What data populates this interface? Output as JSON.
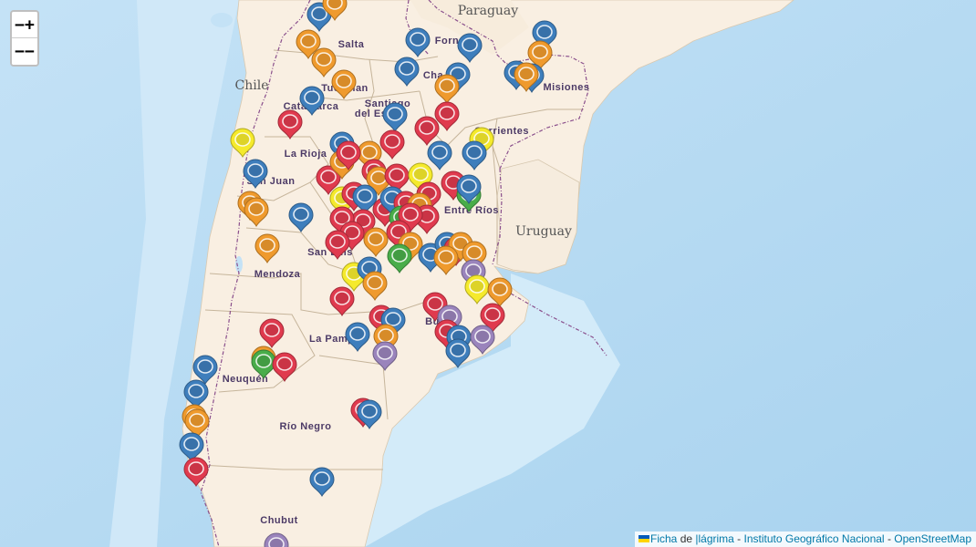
{
  "zoom": {
    "in_label": "−+",
    "out_label": "−−"
  },
  "attribution": {
    "ficha": "Ficha",
    "de": " de ",
    "lagrima": "|lágrima",
    "sep1": " - ",
    "ign": "Instituto Geográfico Nacional",
    "sep2": " - ",
    "osm": "OpenStreetMap",
    "flag_colors": [
      "#005bbb",
      "#ffd500"
    ]
  },
  "countries": [
    "Paraguay",
    "Chile",
    "Uruguay"
  ],
  "provinces": [
    "Salta",
    "Forn",
    "Misiones",
    "Cha",
    "Tucuman",
    "Catamarca",
    "Santiago del Estero",
    "Corrientes",
    "La Rioja",
    "San Juan",
    "Entre Ríos",
    "San Luis",
    "Mendoza",
    "Bu",
    "La Pampa",
    "Neuquén",
    "Río Negro",
    "Chubut"
  ],
  "marker_colors": {
    "blue": "#3e7ebc",
    "orange": "#ef9a2d",
    "red": "#e03a4e",
    "yellow": "#f5ea2c",
    "green": "#49ad4a",
    "purple": "#9a84bc"
  },
  "markers": [
    [
      "blue",
      350,
      18
    ],
    [
      "orange",
      367,
      6
    ],
    [
      "orange",
      338,
      48
    ],
    [
      "orange",
      355,
      68
    ],
    [
      "orange",
      377,
      92
    ],
    [
      "blue",
      458,
      46
    ],
    [
      "blue",
      515,
      52
    ],
    [
      "blue",
      446,
      78
    ],
    [
      "blue",
      502,
      84
    ],
    [
      "orange",
      490,
      97
    ],
    [
      "blue",
      597,
      38
    ],
    [
      "orange",
      592,
      60
    ],
    [
      "blue",
      566,
      82
    ],
    [
      "blue",
      583,
      85
    ],
    [
      "orange",
      577,
      84
    ],
    [
      "blue",
      342,
      110
    ],
    [
      "red",
      318,
      136
    ],
    [
      "yellow",
      266,
      156
    ],
    [
      "blue",
      433,
      128
    ],
    [
      "red",
      490,
      127
    ],
    [
      "red",
      468,
      143
    ],
    [
      "yellow",
      528,
      155
    ],
    [
      "blue",
      520,
      170
    ],
    [
      "blue",
      482,
      170
    ],
    [
      "red",
      430,
      158
    ],
    [
      "blue",
      375,
      160
    ],
    [
      "orange",
      405,
      170
    ],
    [
      "red",
      360,
      197
    ],
    [
      "orange",
      375,
      180
    ],
    [
      "red",
      382,
      170
    ],
    [
      "red",
      410,
      190
    ],
    [
      "orange",
      415,
      198
    ],
    [
      "red",
      435,
      195
    ],
    [
      "yellow",
      461,
      194
    ],
    [
      "blue",
      280,
      190
    ],
    [
      "red",
      497,
      203
    ],
    [
      "green",
      514,
      216
    ],
    [
      "blue",
      514,
      207
    ],
    [
      "orange",
      274,
      225
    ],
    [
      "orange",
      281,
      232
    ],
    [
      "blue",
      330,
      238
    ],
    [
      "yellow",
      375,
      220
    ],
    [
      "red",
      388,
      215
    ],
    [
      "blue",
      400,
      218
    ],
    [
      "red",
      398,
      245
    ],
    [
      "red",
      422,
      232
    ],
    [
      "blue",
      430,
      220
    ],
    [
      "red",
      445,
      225
    ],
    [
      "red",
      470,
      215
    ],
    [
      "orange",
      460,
      227
    ],
    [
      "red",
      468,
      240
    ],
    [
      "green",
      440,
      241
    ],
    [
      "red",
      450,
      238
    ],
    [
      "red",
      375,
      242
    ],
    [
      "red",
      386,
      258
    ],
    [
      "red",
      437,
      257
    ],
    [
      "orange",
      412,
      265
    ],
    [
      "red",
      370,
      268
    ],
    [
      "orange",
      293,
      272
    ],
    [
      "orange",
      450,
      270
    ],
    [
      "green",
      438,
      283
    ],
    [
      "blue",
      472,
      282
    ],
    [
      "blue",
      490,
      270
    ],
    [
      "red",
      500,
      275
    ],
    [
      "orange",
      505,
      270
    ],
    [
      "orange",
      520,
      280
    ],
    [
      "orange",
      489,
      285
    ],
    [
      "yellow",
      388,
      303
    ],
    [
      "blue",
      405,
      297
    ],
    [
      "orange",
      411,
      313
    ],
    [
      "purple",
      519,
      300
    ],
    [
      "yellow",
      523,
      317
    ],
    [
      "orange",
      548,
      320
    ],
    [
      "red",
      375,
      330
    ],
    [
      "red",
      477,
      336
    ],
    [
      "purple",
      493,
      350
    ],
    [
      "red",
      540,
      348
    ],
    [
      "red",
      418,
      350
    ],
    [
      "blue",
      431,
      353
    ],
    [
      "red",
      298,
      365
    ],
    [
      "blue",
      392,
      369
    ],
    [
      "orange",
      423,
      371
    ],
    [
      "red",
      490,
      366
    ],
    [
      "blue",
      503,
      372
    ],
    [
      "purple",
      529,
      372
    ],
    [
      "purple",
      422,
      390
    ],
    [
      "blue",
      502,
      387
    ],
    [
      "orange",
      289,
      395
    ],
    [
      "green",
      289,
      399
    ],
    [
      "red",
      312,
      402
    ],
    [
      "blue",
      225,
      405
    ],
    [
      "blue",
      215,
      432
    ],
    [
      "orange",
      213,
      459
    ],
    [
      "orange",
      216,
      464
    ],
    [
      "blue",
      210,
      490
    ],
    [
      "red",
      215,
      517
    ],
    [
      "red",
      398,
      452
    ],
    [
      "blue",
      405,
      454
    ],
    [
      "blue",
      353,
      528
    ],
    [
      "purple",
      303,
      600
    ]
  ]
}
